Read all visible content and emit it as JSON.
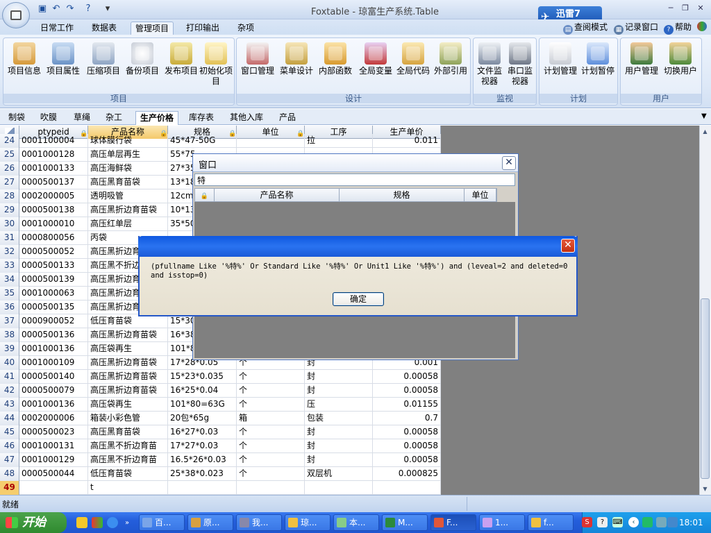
{
  "window": {
    "title": "Foxtable - 琼富生产系统.Table"
  },
  "xunlei": {
    "label": "迅雷7"
  },
  "ribbon_tabs": [
    {
      "label": "日常工作"
    },
    {
      "label": "数据表"
    },
    {
      "label": "管理项目",
      "active": true
    },
    {
      "label": "打印输出"
    },
    {
      "label": "杂项"
    }
  ],
  "title_right": {
    "read_mode": "查阅模式",
    "log_window": "记录窗口",
    "help": "帮助"
  },
  "groups": {
    "project": {
      "label": "项目",
      "buttons": [
        "项目信息",
        "项目属性",
        "压缩项目",
        "备份项目",
        "发布项目",
        "初始化项目"
      ]
    },
    "design": {
      "label": "设计",
      "buttons": [
        "窗口管理",
        "菜单设计",
        "内部函数",
        "全局变量",
        "全局代码",
        "外部引用"
      ]
    },
    "monitor": {
      "label": "监视",
      "buttons": [
        "文件监视器",
        "串口监视器"
      ]
    },
    "plan": {
      "label": "计划",
      "buttons": [
        "计划管理",
        "计划暂停"
      ]
    },
    "user": {
      "label": "用户",
      "buttons": [
        "用户管理",
        "切换用户"
      ]
    }
  },
  "sheet_tabs": [
    "制袋",
    "吹膜",
    "草绳",
    "杂工",
    "生产价格",
    "库存表",
    "其他入库",
    "产品"
  ],
  "grid": {
    "columns": [
      "ptypeid",
      "产品名称",
      "规格",
      "单位",
      "工序",
      "生产单价"
    ],
    "rows": [
      {
        "n": "24",
        "id": "0001100004",
        "name": "球体膜行袋",
        "spec": "45*47-50G",
        "unit": "",
        "proc": "拉",
        "price": "0.011"
      },
      {
        "n": "25",
        "id": "0001000128",
        "name": "高压单层再生",
        "spec": "55*75",
        "unit": "",
        "proc": "",
        "price": ""
      },
      {
        "n": "26",
        "id": "0001000133",
        "name": "高压海鲜袋",
        "spec": "27*35",
        "unit": "",
        "proc": "",
        "price": ""
      },
      {
        "n": "27",
        "id": "0000500137",
        "name": "高压黑育苗袋",
        "spec": "13*18",
        "unit": "",
        "proc": "",
        "price": ""
      },
      {
        "n": "28",
        "id": "0002000005",
        "name": "透明吸管",
        "spec": "12cm*",
        "unit": "",
        "proc": "",
        "price": ""
      },
      {
        "n": "29",
        "id": "0000500138",
        "name": "高压黑折边育苗袋",
        "spec": "10*13",
        "unit": "",
        "proc": "",
        "price": ""
      },
      {
        "n": "30",
        "id": "0001000010",
        "name": "高压红单层",
        "spec": "35*50",
        "unit": "",
        "proc": "",
        "price": ""
      },
      {
        "n": "31",
        "id": "0000800056",
        "name": "丙袋",
        "spec": "",
        "unit": "",
        "proc": "",
        "price": ""
      },
      {
        "n": "32",
        "id": "0000500052",
        "name": "高压黑折边育",
        "spec": "",
        "unit": "",
        "proc": "",
        "price": ""
      },
      {
        "n": "33",
        "id": "0000500133",
        "name": "高压黑不折边",
        "spec": "",
        "unit": "",
        "proc": "",
        "price": ""
      },
      {
        "n": "34",
        "id": "0000500139",
        "name": "高压黑折边育",
        "spec": "",
        "unit": "",
        "proc": "",
        "price": ""
      },
      {
        "n": "35",
        "id": "0001000063",
        "name": "高压黑折边育",
        "spec": "",
        "unit": "",
        "proc": "",
        "price": ""
      },
      {
        "n": "36",
        "id": "0000500135",
        "name": "高压黑折边育",
        "spec": "",
        "unit": "",
        "proc": "",
        "price": ""
      },
      {
        "n": "37",
        "id": "0000900052",
        "name": "低压育苗袋",
        "spec": "15*30",
        "unit": "",
        "proc": "",
        "price": ""
      },
      {
        "n": "38",
        "id": "0000500136",
        "name": "高压黑折边育苗袋",
        "spec": "16*38",
        "unit": "",
        "proc": "",
        "price": ""
      },
      {
        "n": "39",
        "id": "0001000136",
        "name": "高压袋再生",
        "spec": "101*8",
        "unit": "",
        "proc": "",
        "price": ""
      },
      {
        "n": "40",
        "id": "0001000109",
        "name": "高压黑折边育苗袋",
        "spec": "17*28*0.05",
        "unit": "个",
        "proc": "封",
        "price": "0.001"
      },
      {
        "n": "41",
        "id": "0000500140",
        "name": "高压黑折边育苗袋",
        "spec": "15*23*0.035",
        "unit": "个",
        "proc": "封",
        "price": "0.00058"
      },
      {
        "n": "42",
        "id": "0000500079",
        "name": "高压黑折边育苗袋",
        "spec": "16*25*0.04",
        "unit": "个",
        "proc": "封",
        "price": "0.00058"
      },
      {
        "n": "43",
        "id": "0001000136",
        "name": "高压袋再生",
        "spec": "101*80=63G",
        "unit": "个",
        "proc": "压",
        "price": "0.01155"
      },
      {
        "n": "44",
        "id": "0002000006",
        "name": "箱装小彩色管",
        "spec": "20包*65g",
        "unit": "箱",
        "proc": "包装",
        "price": "0.7"
      },
      {
        "n": "45",
        "id": "0000500023",
        "name": "高压黑育苗袋",
        "spec": "16*27*0.03",
        "unit": "个",
        "proc": "封",
        "price": "0.00058"
      },
      {
        "n": "46",
        "id": "0001000131",
        "name": "高压黑不折边育苗",
        "spec": "17*27*0.03",
        "unit": "个",
        "proc": "封",
        "price": "0.00058"
      },
      {
        "n": "47",
        "id": "0001000129",
        "name": "高压黑不折边育苗",
        "spec": "16.5*26*0.03",
        "unit": "个",
        "proc": "封",
        "price": "0.00058"
      },
      {
        "n": "48",
        "id": "0000500044",
        "name": "低压育苗袋",
        "spec": "25*38*0.023",
        "unit": "个",
        "proc": "双层机",
        "price": "0.000825"
      },
      {
        "n": "49",
        "id": "",
        "name": "t",
        "spec": "",
        "unit": "",
        "proc": "",
        "price": ""
      }
    ]
  },
  "child_window": {
    "title": "窗口",
    "search_value": "特",
    "columns": [
      "产品名称",
      "规格",
      "单位"
    ]
  },
  "message_box": {
    "text": "(pfullname Like '%特%' Or Standard Like '%特%' Or Unit1 Like '%特%') and (leveal=2 and deleted=0 and isstop=0)",
    "ok_label": "确定"
  },
  "status": {
    "text": "就绪"
  },
  "taskbar": {
    "start_label": "开始",
    "items": [
      "百...",
      "原...",
      "我...",
      "琼...",
      "本...",
      "M...",
      "F...",
      "1...",
      "f..."
    ],
    "clock": "18:01"
  },
  "colors": {
    "ribbon_bg": "#dde8f7",
    "selected_header": "#f4c96a",
    "dialog_title": "#1a5ad8",
    "taskbar": "#245edb"
  }
}
